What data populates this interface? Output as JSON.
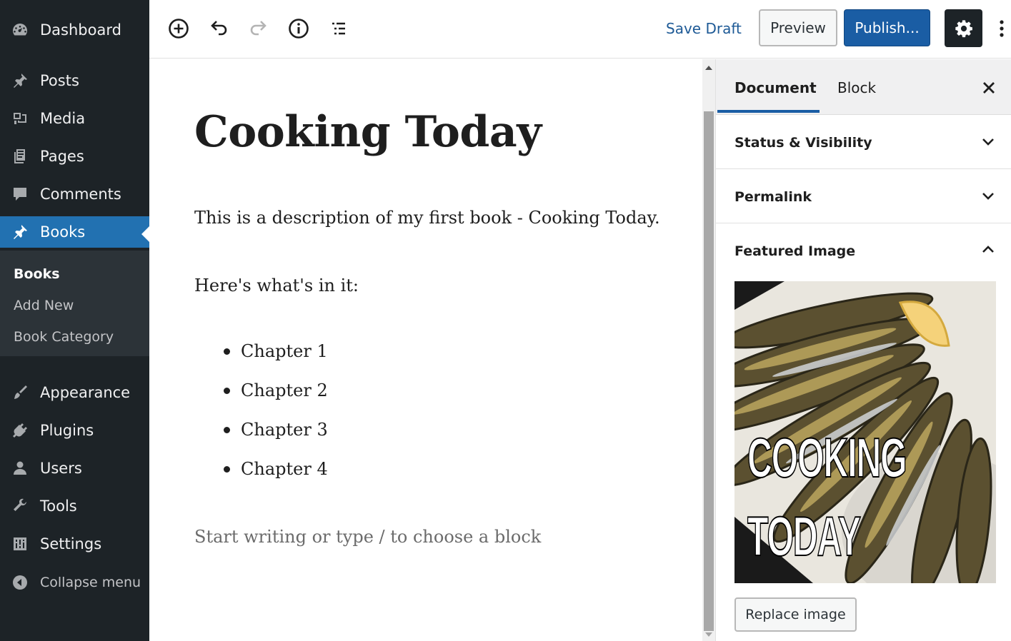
{
  "admin_menu": {
    "dashboard": "Dashboard",
    "posts": "Posts",
    "media": "Media",
    "pages": "Pages",
    "comments": "Comments",
    "books": "Books",
    "books_submenu": [
      "Books",
      "Add New",
      "Book Category"
    ],
    "appearance": "Appearance",
    "plugins": "Plugins",
    "users": "Users",
    "tools": "Tools",
    "settings": "Settings",
    "collapse": "Collapse menu"
  },
  "toolbar": {
    "icons": [
      "add-block-icon",
      "undo-icon",
      "redo-icon",
      "info-icon",
      "list-view-icon"
    ],
    "save_draft": "Save Draft",
    "preview": "Preview",
    "publish": "Publish...",
    "settings_icon": "gear-icon",
    "more_icon": "more-vertical-icon"
  },
  "editor": {
    "title": "Cooking Today",
    "paragraph_1": "This is a description of my first book - Cooking Today.",
    "paragraph_2": "Here's what's in it:",
    "list_items": [
      "Chapter 1",
      "Chapter 2",
      "Chapter 3",
      "Chapter 4"
    ],
    "placeholder": "Start writing or type / to choose a block"
  },
  "settings_sidebar": {
    "tabs": [
      "Document",
      "Block"
    ],
    "active_tab": "Document",
    "panels": [
      "Status & Visibility",
      "Permalink",
      "Featured Image"
    ],
    "featured_image_text": [
      "COOKING",
      "TODAY"
    ],
    "replace_image": "Replace image"
  },
  "colors": {
    "admin_bg": "#1d2327",
    "accent": "#2271b1",
    "publish": "#1a5da4"
  }
}
